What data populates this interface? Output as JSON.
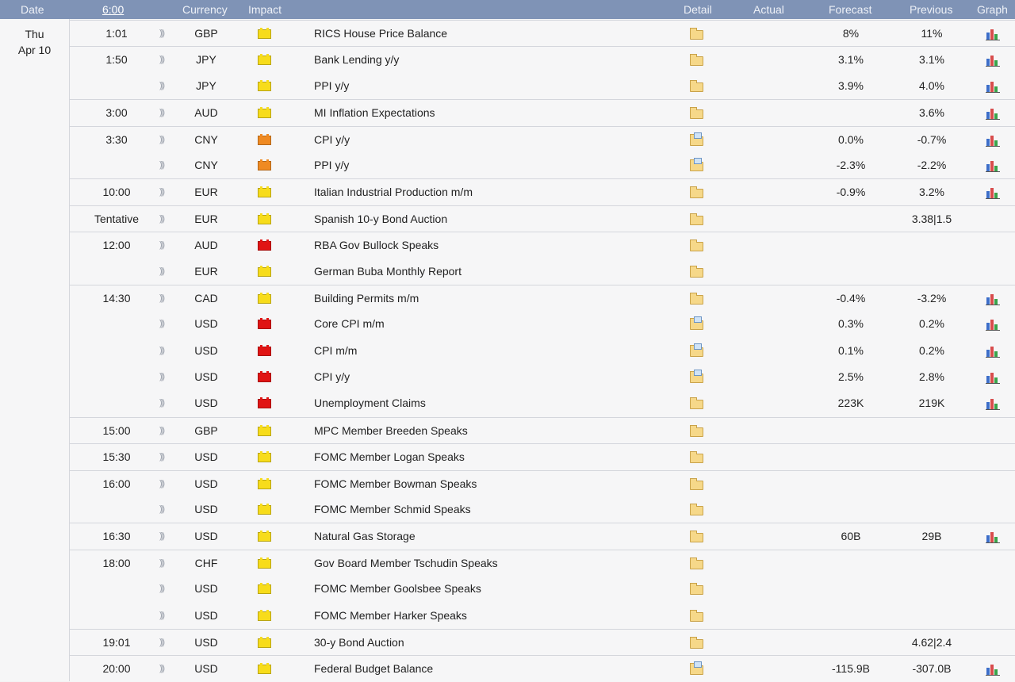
{
  "header": {
    "date": "Date",
    "time": "6:00",
    "currency": "Currency",
    "impact": "Impact",
    "detail": "Detail",
    "actual": "Actual",
    "forecast": "Forecast",
    "previous": "Previous",
    "graph": "Graph"
  },
  "day": {
    "weekday": "Thu",
    "date": "Apr 10"
  },
  "impact_colors": {
    "low": "#f7dc1b",
    "medium": "#ef8a22",
    "high": "#e01414"
  },
  "events": [
    {
      "time": "1:01",
      "currency": "GBP",
      "impact": "low",
      "event": "RICS House Price Balance",
      "detail": "folder-icon",
      "actual": "",
      "forecast": "8%",
      "previous": "11%",
      "graph": true
    },
    {
      "time": "1:50",
      "currency": "JPY",
      "impact": "low",
      "event": "Bank Lending y/y",
      "detail": "folder-icon",
      "actual": "",
      "forecast": "3.1%",
      "previous": "3.1%",
      "graph": true
    },
    {
      "time": "",
      "currency": "JPY",
      "impact": "low",
      "event": "PPI y/y",
      "detail": "folder-icon",
      "actual": "",
      "forecast": "3.9%",
      "previous": "4.0%",
      "graph": true
    },
    {
      "time": "3:00",
      "currency": "AUD",
      "impact": "low",
      "event": "MI Inflation Expectations",
      "detail": "folder-icon",
      "actual": "",
      "forecast": "",
      "previous": "3.6%",
      "graph": true
    },
    {
      "time": "3:30",
      "currency": "CNY",
      "impact": "medium",
      "event": "CPI y/y",
      "detail": "folder-document-icon",
      "actual": "",
      "forecast": "0.0%",
      "previous": "-0.7%",
      "graph": true
    },
    {
      "time": "",
      "currency": "CNY",
      "impact": "medium",
      "event": "PPI y/y",
      "detail": "folder-document-icon",
      "actual": "",
      "forecast": "-2.3%",
      "previous": "-2.2%",
      "graph": true
    },
    {
      "time": "10:00",
      "currency": "EUR",
      "impact": "low",
      "event": "Italian Industrial Production m/m",
      "detail": "folder-icon",
      "actual": "",
      "forecast": "-0.9%",
      "previous": "3.2%",
      "graph": true
    },
    {
      "time": "Tentative",
      "currency": "EUR",
      "impact": "low",
      "event": "Spanish 10-y Bond Auction",
      "detail": "folder-icon",
      "actual": "",
      "forecast": "",
      "previous": "3.38|1.5",
      "graph": false
    },
    {
      "time": "12:00",
      "currency": "AUD",
      "impact": "high",
      "event": "RBA Gov Bullock Speaks",
      "detail": "folder-icon",
      "actual": "",
      "forecast": "",
      "previous": "",
      "graph": false
    },
    {
      "time": "",
      "currency": "EUR",
      "impact": "low",
      "event": "German Buba Monthly Report",
      "detail": "folder-icon",
      "actual": "",
      "forecast": "",
      "previous": "",
      "graph": false
    },
    {
      "time": "14:30",
      "currency": "CAD",
      "impact": "low",
      "event": "Building Permits m/m",
      "detail": "folder-icon",
      "actual": "",
      "forecast": "-0.4%",
      "previous": "-3.2%",
      "graph": true
    },
    {
      "time": "",
      "currency": "USD",
      "impact": "high",
      "event": "Core CPI m/m",
      "detail": "folder-document-icon",
      "actual": "",
      "forecast": "0.3%",
      "previous": "0.2%",
      "graph": true
    },
    {
      "time": "",
      "currency": "USD",
      "impact": "high",
      "event": "CPI m/m",
      "detail": "folder-document-icon",
      "actual": "",
      "forecast": "0.1%",
      "previous": "0.2%",
      "graph": true
    },
    {
      "time": "",
      "currency": "USD",
      "impact": "high",
      "event": "CPI y/y",
      "detail": "folder-document-icon",
      "actual": "",
      "forecast": "2.5%",
      "previous": "2.8%",
      "graph": true
    },
    {
      "time": "",
      "currency": "USD",
      "impact": "high",
      "event": "Unemployment Claims",
      "detail": "folder-icon",
      "actual": "",
      "forecast": "223K",
      "previous": "219K",
      "graph": true
    },
    {
      "time": "15:00",
      "currency": "GBP",
      "impact": "low",
      "event": "MPC Member Breeden Speaks",
      "detail": "folder-icon",
      "actual": "",
      "forecast": "",
      "previous": "",
      "graph": false
    },
    {
      "time": "15:30",
      "currency": "USD",
      "impact": "low",
      "event": "FOMC Member Logan Speaks",
      "detail": "folder-icon",
      "actual": "",
      "forecast": "",
      "previous": "",
      "graph": false
    },
    {
      "time": "16:00",
      "currency": "USD",
      "impact": "low",
      "event": "FOMC Member Bowman Speaks",
      "detail": "folder-icon",
      "actual": "",
      "forecast": "",
      "previous": "",
      "graph": false
    },
    {
      "time": "",
      "currency": "USD",
      "impact": "low",
      "event": "FOMC Member Schmid Speaks",
      "detail": "folder-icon",
      "actual": "",
      "forecast": "",
      "previous": "",
      "graph": false
    },
    {
      "time": "16:30",
      "currency": "USD",
      "impact": "low",
      "event": "Natural Gas Storage",
      "detail": "folder-icon",
      "actual": "",
      "forecast": "60B",
      "previous": "29B",
      "graph": true
    },
    {
      "time": "18:00",
      "currency": "CHF",
      "impact": "low",
      "event": "Gov Board Member Tschudin Speaks",
      "detail": "folder-icon",
      "actual": "",
      "forecast": "",
      "previous": "",
      "graph": false
    },
    {
      "time": "",
      "currency": "USD",
      "impact": "low",
      "event": "FOMC Member Goolsbee Speaks",
      "detail": "folder-icon",
      "actual": "",
      "forecast": "",
      "previous": "",
      "graph": false
    },
    {
      "time": "",
      "currency": "USD",
      "impact": "low",
      "event": "FOMC Member Harker Speaks",
      "detail": "folder-icon",
      "actual": "",
      "forecast": "",
      "previous": "",
      "graph": false
    },
    {
      "time": "19:01",
      "currency": "USD",
      "impact": "low",
      "event": "30-y Bond Auction",
      "detail": "folder-icon",
      "actual": "",
      "forecast": "",
      "previous": "4.62|2.4",
      "graph": false
    },
    {
      "time": "20:00",
      "currency": "USD",
      "impact": "low",
      "event": "Federal Budget Balance",
      "detail": "folder-document-icon",
      "actual": "",
      "forecast": "-115.9B",
      "previous": "-307.0B",
      "graph": true
    }
  ]
}
